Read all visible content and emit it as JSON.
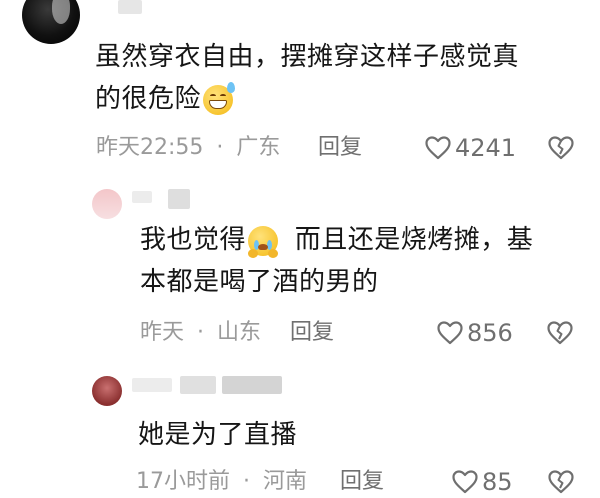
{
  "comments": [
    {
      "text_line1": "虽然穿衣自由，摆摊穿这样子感觉真",
      "text_line2": "的很危险",
      "emoji": "grimacing-sweat-emoji",
      "time": "昨天22:55",
      "location": "广东",
      "reply_label": "回复",
      "likes": "4241"
    },
    {
      "text_line1_a": "我也觉得",
      "text_line1_b": "而且还是烧烤摊，基",
      "text_line2": "本都是喝了酒的男的",
      "emoji": "crying-pleading-emoji",
      "time": "昨天",
      "location": "山东",
      "reply_label": "回复",
      "likes": "856"
    },
    {
      "text_line1": "她是为了直播",
      "time": "17小时前",
      "location": "河南",
      "reply_label": "回复",
      "likes": "85"
    }
  ],
  "separator": "·",
  "icons": {
    "like": "heart-outline-icon",
    "dislike": "broken-heart-outline-icon"
  },
  "colors": {
    "text": "#161616",
    "meta": "#9a9a9a",
    "icon": "#6f6f6f"
  }
}
